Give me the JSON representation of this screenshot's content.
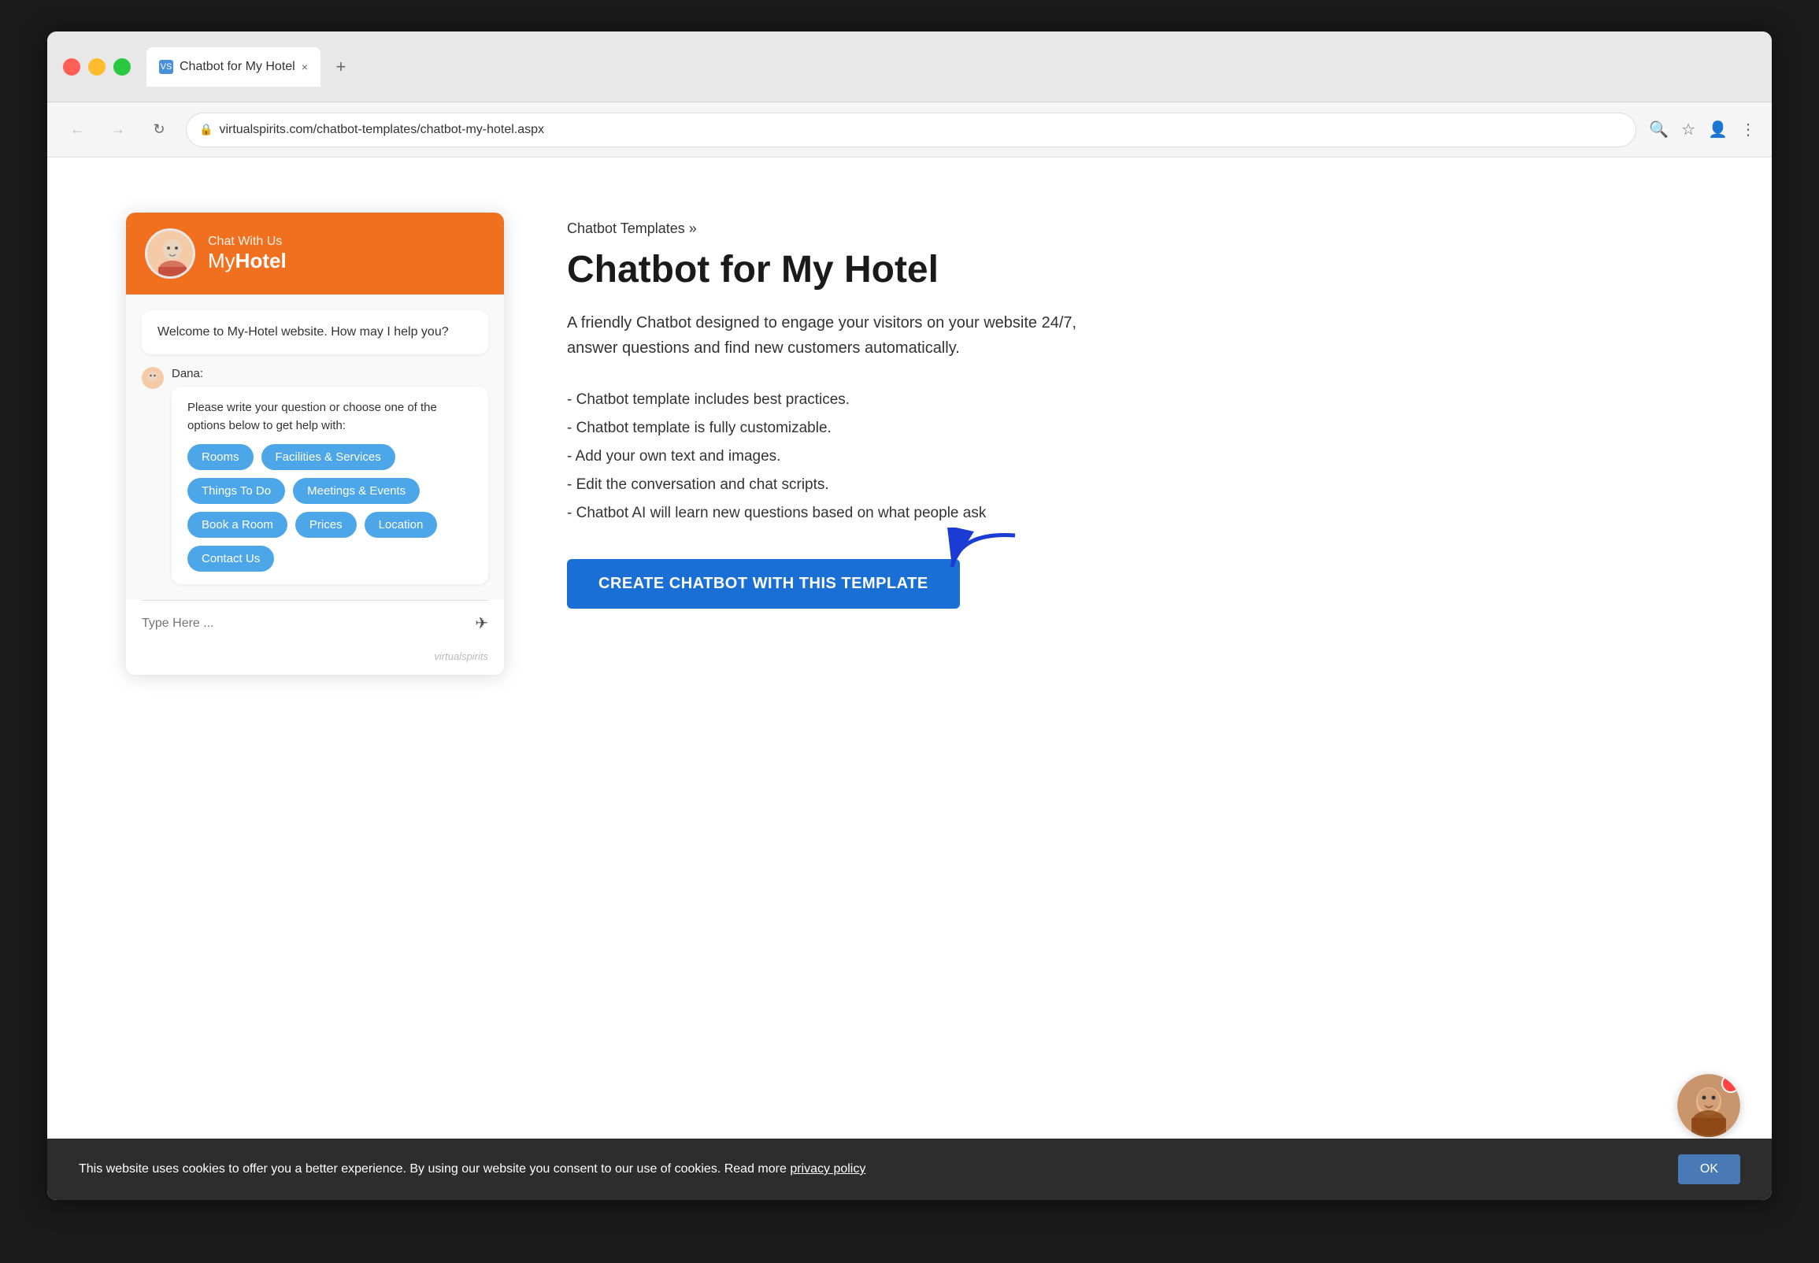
{
  "browser": {
    "traffic_lights": [
      "red",
      "yellow",
      "green"
    ],
    "tab_label": "Chatbot for My Hotel",
    "tab_close": "×",
    "new_tab": "+",
    "nav_back": "←",
    "nav_forward": "→",
    "nav_reload": "↻",
    "address": "virtualspirits.com/chatbot-templates/chatbot-my-hotel.aspx",
    "search_icon": "🔍",
    "star_icon": "☆",
    "user_icon": "👤",
    "menu_icon": "⋮"
  },
  "chatbot": {
    "header_subtitle": "Chat With Us",
    "header_title_my": "My",
    "header_title_hotel": "Hotel",
    "welcome_message": "Welcome to My-Hotel website. How may I help you?",
    "agent_name": "Dana:",
    "agent_message": "Please write your question or choose one of the options below to get help with:",
    "options": [
      "Rooms",
      "Facilities & Services",
      "Things To Do",
      "Meetings & Events",
      "Book a Room",
      "Prices",
      "Location",
      "Contact Us"
    ],
    "input_placeholder": "Type Here ...",
    "send_icon": "✈",
    "branding": "virtualspirits"
  },
  "page": {
    "breadcrumb": "Chatbot Templates »",
    "title": "Chatbot for My Hotel",
    "description": "A friendly Chatbot designed to engage your visitors on your website 24/7, answer questions and find new customers automatically.",
    "features": [
      "- Chatbot template includes best practices.",
      "- Chatbot template is fully customizable.",
      "- Add your own text and images.",
      "- Edit the conversation and chat scripts.",
      "- Chatbot AI will learn new questions based on what people ask"
    ],
    "cta_label": "CREATE CHATBOT WITH THIS TEMPLATE"
  },
  "cookie": {
    "message": "This website uses cookies to offer you a better experience. By using our website you consent to our use of cookies. Read more",
    "link_text": "privacy policy",
    "ok_label": "OK"
  }
}
